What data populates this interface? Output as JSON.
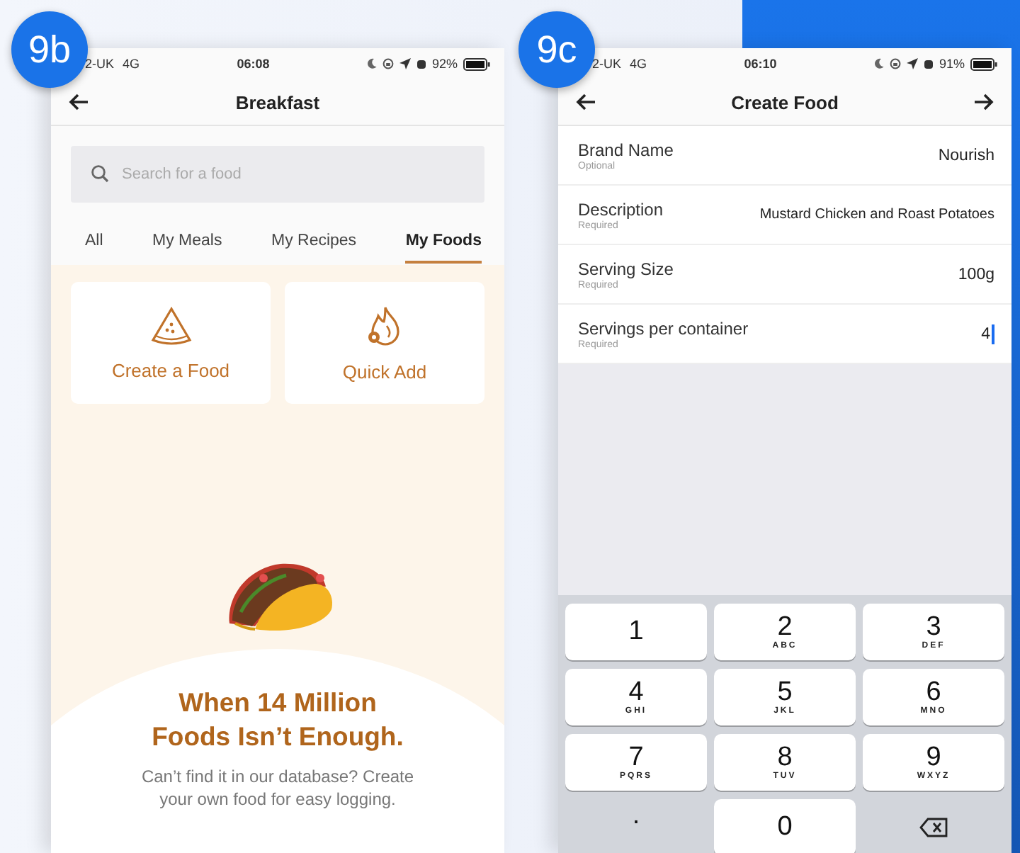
{
  "screens": [
    {
      "badge": "9b",
      "status": {
        "carrier": "2-UK",
        "network": "4G",
        "time": "06:08",
        "battery": "92%"
      },
      "header": {
        "title": "Breakfast"
      },
      "search": {
        "placeholder": "Search for a food"
      },
      "tabs": [
        {
          "label": "All",
          "selected": false
        },
        {
          "label": "My Meals",
          "selected": false
        },
        {
          "label": "My Recipes",
          "selected": false
        },
        {
          "label": "My Foods",
          "selected": true
        }
      ],
      "cards": [
        {
          "kind": "create",
          "label": "Create a Food"
        },
        {
          "kind": "quick",
          "label": "Quick Add"
        }
      ],
      "promo": {
        "heading": "When 14 Million Foods Isn’t Enough.",
        "text": "Can’t find it in our database? Create your own food for easy logging."
      }
    },
    {
      "badge": "9c",
      "status": {
        "carrier": "2-UK",
        "network": "4G",
        "time": "06:10",
        "battery": "91%"
      },
      "header": {
        "title": "Create Food"
      },
      "fields": [
        {
          "label": "Brand Name",
          "hint": "Optional",
          "value": "Nourish",
          "focused": false
        },
        {
          "label": "Description",
          "hint": "Required",
          "value": "Mustard Chicken and Roast Potatoes",
          "focused": false
        },
        {
          "label": "Serving Size",
          "hint": "Required",
          "value": "100g",
          "focused": false
        },
        {
          "label": "Servings per container",
          "hint": "Required",
          "value": "4",
          "focused": true
        }
      ],
      "keypad": [
        {
          "kind": "key",
          "digit": "1"
        },
        {
          "kind": "key",
          "digit": "2",
          "letters": "ABC"
        },
        {
          "kind": "key",
          "digit": "3",
          "letters": "DEF"
        },
        {
          "kind": "key",
          "digit": "4",
          "letters": "GHI"
        },
        {
          "kind": "key",
          "digit": "5",
          "letters": "JKL"
        },
        {
          "kind": "key",
          "digit": "6",
          "letters": "MNO"
        },
        {
          "kind": "key",
          "digit": "7",
          "letters": "PQRS"
        },
        {
          "kind": "key",
          "digit": "8",
          "letters": "TUV"
        },
        {
          "kind": "key",
          "digit": "9",
          "letters": "WXYZ"
        },
        {
          "kind": "plain",
          "digit": "."
        },
        {
          "kind": "key",
          "digit": "0"
        },
        {
          "kind": "delete"
        }
      ]
    }
  ]
}
